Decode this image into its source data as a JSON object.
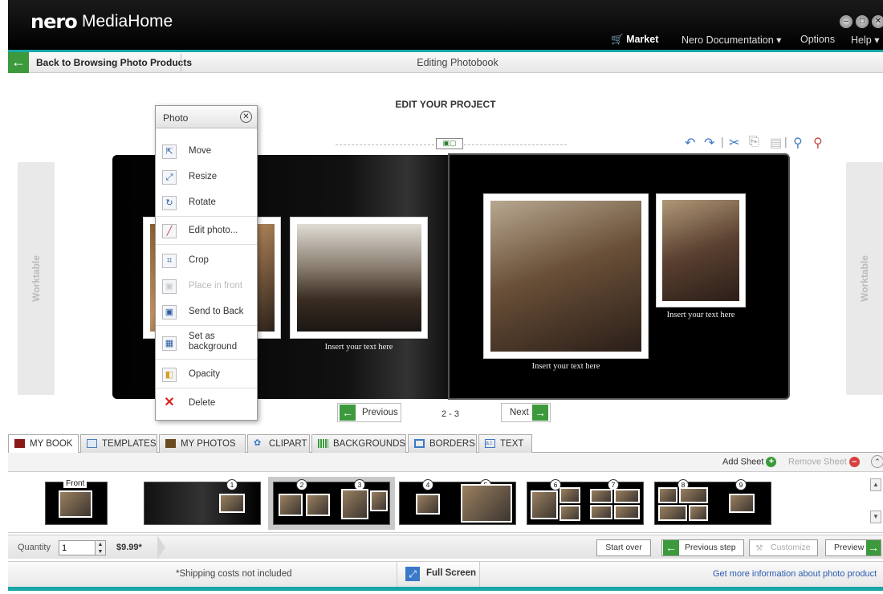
{
  "app": {
    "brand": "nero",
    "product": "MediaHome"
  },
  "window_controls": [
    "minimize",
    "restore",
    "close"
  ],
  "menu": {
    "market": "Market",
    "documentation": "Nero Documentation",
    "options": "Options",
    "help": "Help"
  },
  "nav": {
    "back_label": "Back to Browsing Photo Products",
    "title": "Editing Photobook"
  },
  "editor": {
    "heading": "EDIT YOUR PROJECT",
    "worktable_left": "Worktable",
    "worktable_right": "Worktable",
    "caption_left": "Insert your text here",
    "caption_right_main": "Insert your text here",
    "caption_right_small": "Insert your text here",
    "tools": [
      "undo-icon",
      "redo-icon",
      "cut-icon",
      "copy-icon",
      "paste-icon",
      "zoom-in-icon",
      "zoom-out-icon"
    ]
  },
  "context_menu": {
    "title": "Photo",
    "items": [
      {
        "label": "Move",
        "enabled": true
      },
      {
        "label": "Resize",
        "enabled": true
      },
      {
        "label": "Rotate",
        "enabled": true
      },
      {
        "label": "Edit photo...",
        "enabled": true
      },
      {
        "label": "Crop",
        "enabled": true
      },
      {
        "label": "Place in front",
        "enabled": false
      },
      {
        "label": "Send to Back",
        "enabled": true
      },
      {
        "label": "Set as background",
        "enabled": true
      },
      {
        "label": "Opacity",
        "enabled": true
      },
      {
        "label": "Delete",
        "enabled": true
      }
    ]
  },
  "pager": {
    "previous": "Previous",
    "next": "Next",
    "current": "2 - 3"
  },
  "tabs": [
    {
      "label": "MY BOOK",
      "active": true
    },
    {
      "label": "TEMPLATES",
      "active": false
    },
    {
      "label": "MY PHOTOS",
      "active": false
    },
    {
      "label": "CLIPART",
      "active": false
    },
    {
      "label": "BACKGROUNDS",
      "active": false
    },
    {
      "label": "BORDERS",
      "active": false
    },
    {
      "label": "TEXT",
      "active": false
    }
  ],
  "sheet": {
    "add": "Add Sheet",
    "remove": "Remove Sheet"
  },
  "filmstrip": {
    "front": "Front",
    "pages": [
      "1",
      "2",
      "3",
      "4",
      "5",
      "6",
      "7",
      "8",
      "9"
    ]
  },
  "order": {
    "quantity_label": "Quantity",
    "quantity_value": "1",
    "price": "$9.99*",
    "start_over": "Start over",
    "previous_step": "Previous step",
    "customize": "Customize",
    "preview": "Preview"
  },
  "footer": {
    "shipping": "*Shipping costs not included",
    "full_screen": "Full Screen",
    "more_info": "Get more information about photo product"
  },
  "colors": {
    "accent_teal": "#1aa6a6",
    "green": "#3c9a3c",
    "title_bar": "#000000"
  }
}
